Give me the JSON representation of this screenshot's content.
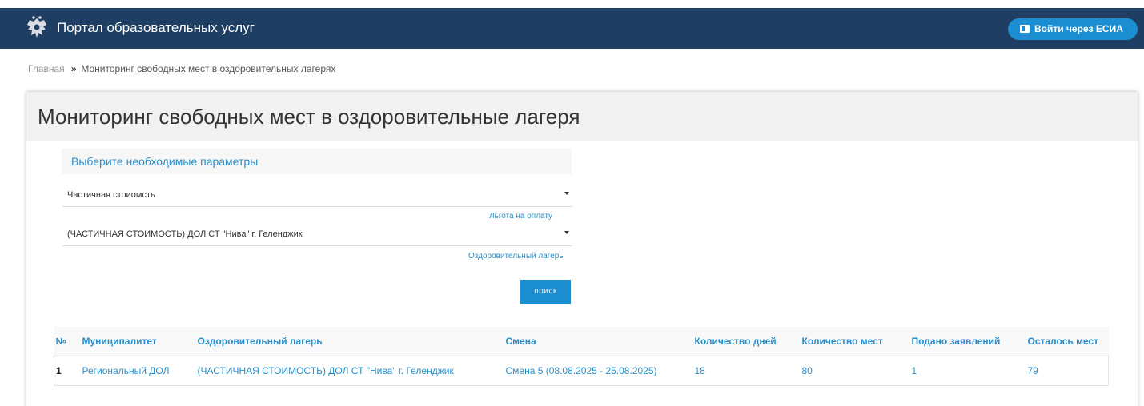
{
  "header": {
    "brand_title": "Портал образовательных услуг",
    "esia_button": "Войти через ЕСИА"
  },
  "breadcrumb": {
    "home": "Главная",
    "separator": "»",
    "current": "Мониторинг свободных мест в оздоровительных лагерях"
  },
  "panel": {
    "title": "Мониторинг свободных мест в оздоровительные лагеря",
    "params_title": "Выберите необходимые параметры",
    "benefit_select": {
      "value": "Частичная стоиомсть",
      "hint": "Льгота на оплату"
    },
    "camp_select": {
      "value": "(ЧАСТИЧНАЯ СТОИМОСТЬ) ДОЛ СТ \"Нива\" г. Геленджик",
      "hint": "Оздоровительный лагерь"
    },
    "search_button": "поиск"
  },
  "table": {
    "headers": [
      "№",
      "Муниципалитет",
      "Оздоровительный лагерь",
      "Смена",
      "Количество дней",
      "Количество мест",
      "Подано заявлений",
      "Осталось мест"
    ],
    "rows": [
      [
        "1",
        "Региональный ДОЛ",
        "(ЧАСТИЧНАЯ СТОИМОСТЬ) ДОЛ СТ \"Нива\" г. Геленджик",
        "Смена 5 (08.08.2025 - 25.08.2025)",
        "18",
        "80",
        "1",
        "79"
      ]
    ]
  },
  "colors": {
    "topbar": "#1e3f63",
    "accent": "#1b8ed1",
    "link": "#2a8fc8"
  }
}
